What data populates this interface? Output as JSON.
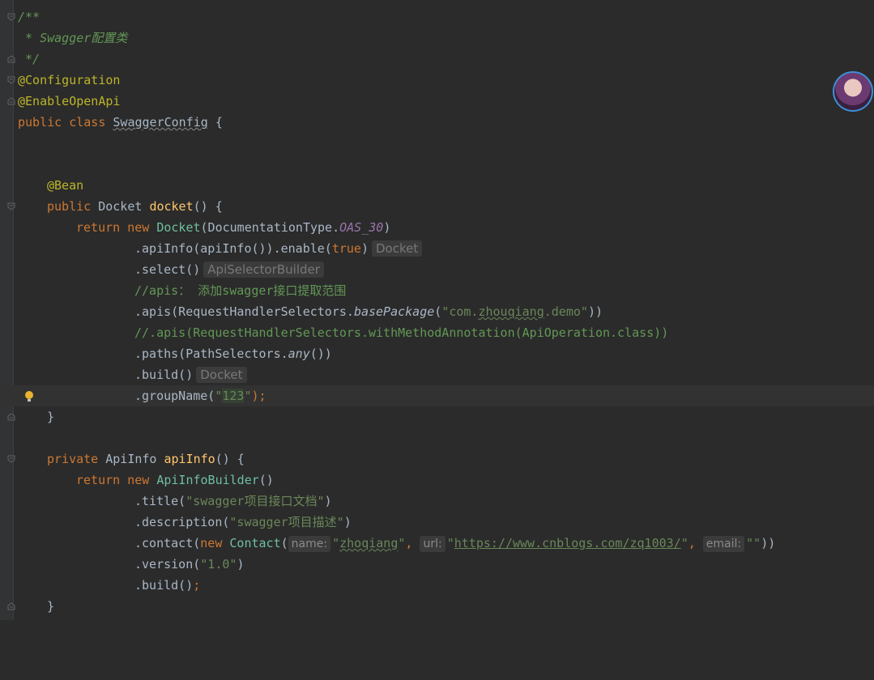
{
  "editor": {
    "lines": [
      {
        "id": "l1",
        "text": "/**"
      },
      {
        "id": "l2",
        "text": " * Swagger配置类"
      },
      {
        "id": "l3",
        "text": " */"
      },
      {
        "id": "l4",
        "text": "@Configuration"
      },
      {
        "id": "l5",
        "text": "@EnableOpenApi"
      },
      {
        "id": "l6a",
        "text": "public class "
      },
      {
        "id": "l6b",
        "text": "SwaggerConfig"
      },
      {
        "id": "l6c",
        "text": " {"
      },
      {
        "id": "l9",
        "text": "@Bean"
      },
      {
        "id": "l10a",
        "text": "public "
      },
      {
        "id": "l10b",
        "text": "Docket "
      },
      {
        "id": "l10c",
        "text": "docket"
      },
      {
        "id": "l10d",
        "text": "() {"
      },
      {
        "id": "l11a",
        "text": "return new "
      },
      {
        "id": "l11b",
        "text": "Docket"
      },
      {
        "id": "l11c",
        "text": "(DocumentationType."
      },
      {
        "id": "l11d",
        "text": "OAS_30"
      },
      {
        "id": "l11e",
        "text": ")"
      },
      {
        "id": "l12a",
        "text": ".apiInfo(apiInfo()).enable("
      },
      {
        "id": "l12b",
        "text": "true"
      },
      {
        "id": "l12c",
        "text": ")"
      },
      {
        "id": "l12hint",
        "text": "Docket"
      },
      {
        "id": "l13a",
        "text": ".select()"
      },
      {
        "id": "l13hint",
        "text": "ApiSelectorBuilder"
      },
      {
        "id": "l14",
        "text": "//apis： 添加swagger接口提取范围"
      },
      {
        "id": "l15a",
        "text": ".apis(RequestHandlerSelectors."
      },
      {
        "id": "l15b",
        "text": "basePackage"
      },
      {
        "id": "l15c",
        "text": "("
      },
      {
        "id": "l15d",
        "text": "\"com."
      },
      {
        "id": "l15e",
        "text": "zhouqiang"
      },
      {
        "id": "l15f",
        "text": ".demo\""
      },
      {
        "id": "l15g",
        "text": "))"
      },
      {
        "id": "l16",
        "text": "//.apis(RequestHandlerSelectors.withMethodAnnotation(ApiOperation.class))"
      },
      {
        "id": "l17a",
        "text": ".paths(PathSelectors."
      },
      {
        "id": "l17b",
        "text": "any"
      },
      {
        "id": "l17c",
        "text": "())"
      },
      {
        "id": "l18a",
        "text": ".build()"
      },
      {
        "id": "l18hint",
        "text": "Docket"
      },
      {
        "id": "l19a",
        "text": ".groupName("
      },
      {
        "id": "l19b",
        "text": "\""
      },
      {
        "id": "l19c",
        "text": "123"
      },
      {
        "id": "l19d",
        "text": "\""
      },
      {
        "id": "l19e",
        "text": ");"
      },
      {
        "id": "l20",
        "text": "}"
      },
      {
        "id": "l22a",
        "text": "private "
      },
      {
        "id": "l22b",
        "text": "ApiInfo "
      },
      {
        "id": "l22c",
        "text": "apiInfo"
      },
      {
        "id": "l22d",
        "text": "() {"
      },
      {
        "id": "l23a",
        "text": "return new "
      },
      {
        "id": "l23b",
        "text": "ApiInfoBuilder"
      },
      {
        "id": "l23c",
        "text": "()"
      },
      {
        "id": "l24a",
        "text": ".title("
      },
      {
        "id": "l24b",
        "text": "\"swagger项目接口文档\""
      },
      {
        "id": "l24c",
        "text": ")"
      },
      {
        "id": "l25a",
        "text": ".description("
      },
      {
        "id": "l25b",
        "text": "\"swagger项目描述\""
      },
      {
        "id": "l25c",
        "text": ")"
      },
      {
        "id": "l26a",
        "text": ".contact("
      },
      {
        "id": "l26b",
        "text": "new "
      },
      {
        "id": "l26c",
        "text": "Contact"
      },
      {
        "id": "l26d",
        "text": "("
      },
      {
        "id": "l26pn1",
        "text": "name:"
      },
      {
        "id": "l26e",
        "text": "\""
      },
      {
        "id": "l26f",
        "text": "zhoqiang"
      },
      {
        "id": "l26g",
        "text": "\""
      },
      {
        "id": "l26h",
        "text": ", "
      },
      {
        "id": "l26pn2",
        "text": "url:"
      },
      {
        "id": "l26i",
        "text": "\""
      },
      {
        "id": "l26j",
        "text": "https://www.cnblogs.com/zq1003/"
      },
      {
        "id": "l26k",
        "text": "\""
      },
      {
        "id": "l26l",
        "text": ", "
      },
      {
        "id": "l26pn3",
        "text": "email:"
      },
      {
        "id": "l26m",
        "text": "\"\""
      },
      {
        "id": "l26n",
        "text": "))"
      },
      {
        "id": "l27a",
        "text": ".version("
      },
      {
        "id": "l27b",
        "text": "\"1.0\""
      },
      {
        "id": "l27c",
        "text": ")"
      },
      {
        "id": "l28a",
        "text": ".build()"
      },
      {
        "id": "l28b",
        "text": ";"
      },
      {
        "id": "l29",
        "text": "}"
      }
    ]
  },
  "t": {
    "l1": "/**",
    "l2": " * Swagger配置类",
    "l3": " */",
    "l4": "@Configuration",
    "l5": "@EnableOpenApi",
    "l6a": "public class ",
    "l6b": "SwaggerConfig",
    "l6c": " {",
    "l9": "@Bean",
    "l10a": "public ",
    "l10b": "Docket ",
    "l10c": "docket",
    "l10d": "() {",
    "l11a": "return new ",
    "l11b": "Docket",
    "l11c": "(DocumentationType.",
    "l11d": "OAS_30",
    "l11e": ")",
    "l12a": ".apiInfo(apiInfo()).enable(",
    "l12b": "true",
    "l12c": ")",
    "l12hint": "Docket",
    "l13a": ".select()",
    "l13hint": "ApiSelectorBuilder",
    "l14": "//apis： 添加swagger接口提取范围",
    "l15a": ".apis(RequestHandlerSelectors.",
    "l15b": "basePackage",
    "l15c": "(",
    "l15d": "\"com.",
    "l15e": "zhouqiang",
    "l15f": ".demo\"",
    "l15g": "))",
    "l16": "//.apis(RequestHandlerSelectors.withMethodAnnotation(ApiOperation.class))",
    "l17a": ".paths(PathSelectors.",
    "l17b": "any",
    "l17c": "())",
    "l18a": ".build()",
    "l18hint": "Docket",
    "l19a": ".groupName(",
    "l19b": "\"",
    "l19c": "123",
    "l19d": "\"",
    "l19e": ");",
    "l20": "}",
    "l22a": "private ",
    "l22b": "ApiInfo ",
    "l22c": "apiInfo",
    "l22d": "() {",
    "l23a": "return new ",
    "l23b": "ApiInfoBuilder",
    "l23c": "()",
    "l24a": ".title(",
    "l24b": "\"swagger项目接口文档\"",
    "l24c": ")",
    "l25a": ".description(",
    "l25b": "\"swagger项目描述\"",
    "l25c": ")",
    "l26a": ".contact(",
    "l26b": "new ",
    "l26c": "Contact",
    "l26d": "(",
    "l26pn1": "name:",
    "l26e": "\"",
    "l26f": "zhoqiang",
    "l26g": "\"",
    "l26h": ", ",
    "l26pn2": "url:",
    "l26i": "\"",
    "l26j": "https://www.cnblogs.com/zq1003/",
    "l26k": "\"",
    "l26l": ", ",
    "l26pn3": "email:",
    "l26m": "\"\"",
    "l26n": "))",
    "l27a": ".version(",
    "l27b": "\"1.0\"",
    "l27c": ")",
    "l28a": ".build()",
    "l28b": ";",
    "l29": "}"
  },
  "colors": {
    "background": "#2b2b2b",
    "keyword": "#cc7832",
    "annotation": "#bbb529",
    "string": "#6a8759",
    "method": "#ffc66d",
    "comment": "#629755"
  },
  "icons": {
    "fold": "fold-marker-icon",
    "bulb": "intention-bulb-icon",
    "avatar": "user-avatar"
  }
}
